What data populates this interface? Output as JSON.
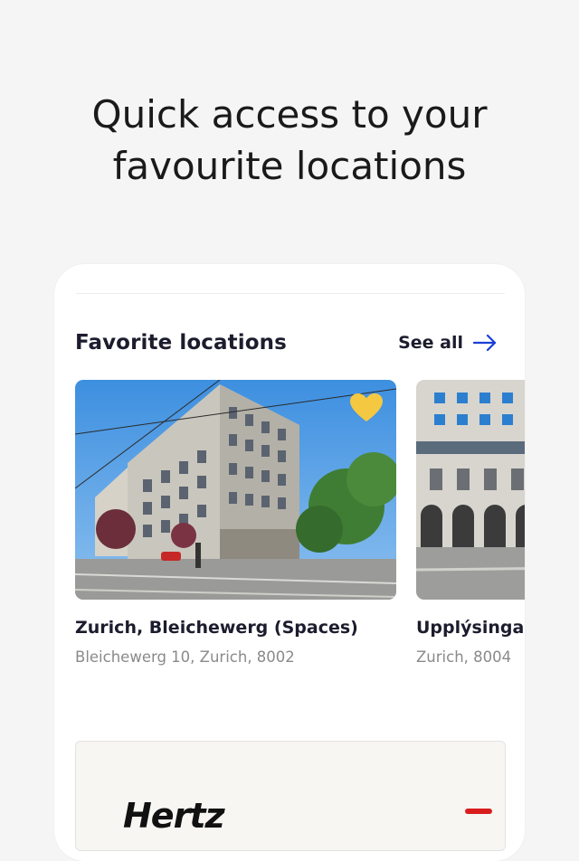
{
  "headline": {
    "line1": "Quick access to your",
    "line2": "favourite locations"
  },
  "favorites": {
    "title": "Favorite locations",
    "see_all_label": "See all",
    "locations": [
      {
        "name": "Zurich, Bleichewerg (Spaces)",
        "address": "Bleichewerg 10, Zurich, 8002",
        "is_favorite": true
      },
      {
        "name": "Upplýsinga",
        "address": "Zurich, 8004"
      }
    ]
  },
  "banner": {
    "logo_text": "Hertz"
  },
  "colors": {
    "accent": "#1a3fd6",
    "heart": "#f5c842",
    "text_primary": "#1c1c2e",
    "text_secondary": "#8a8a8a",
    "background": "#f5f5f5",
    "card": "#ffffff"
  },
  "icons": {
    "see_all": "arrow-right-icon",
    "favorite": "heart-icon"
  }
}
